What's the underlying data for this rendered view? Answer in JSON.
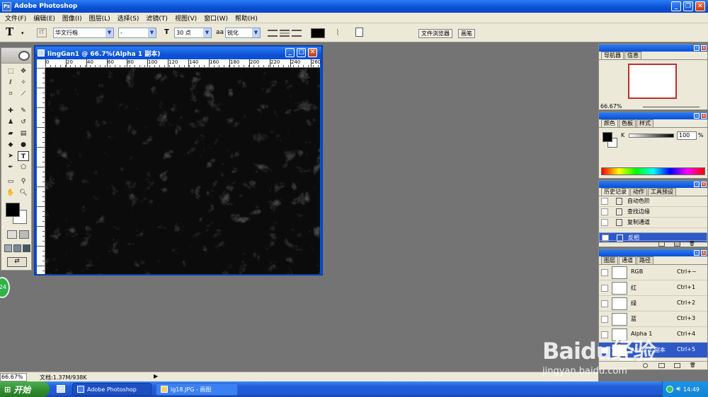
{
  "app": {
    "title": "Adobe Photoshop"
  },
  "menu": [
    "文件(F)",
    "编辑(E)",
    "图像(I)",
    "图层(L)",
    "选择(S)",
    "滤镜(T)",
    "视图(V)",
    "窗口(W)",
    "帮助(H)"
  ],
  "options": {
    "tool_glyph": "T",
    "font_family": "华文行楷",
    "font_style": "-",
    "font_size": "30 点",
    "antialias_label": "aa",
    "antialias": "锐化",
    "tabs": [
      "文件浏览器",
      "画笔"
    ]
  },
  "document": {
    "title": "lingGan1 @ 66.7%(Alpha 1 副本)",
    "ruler_ticks": [
      "0",
      "20",
      "40",
      "60",
      "80",
      "100",
      "120",
      "140",
      "160",
      "180",
      "200",
      "220",
      "240",
      "260"
    ]
  },
  "status": {
    "zoom": "66.67%",
    "doc": "文档:1.37M/938K"
  },
  "navigator": {
    "tabs": [
      "导航器",
      "信息"
    ],
    "zoom": "66.67%"
  },
  "color_panel": {
    "tabs": [
      "颜色",
      "色板",
      "样式"
    ],
    "channel_label": "K",
    "value": "100",
    "unit": "%"
  },
  "history": {
    "tabs": [
      "历史记录",
      "动作",
      "工具预设"
    ],
    "items": [
      {
        "label": "自动色阶",
        "selected": false
      },
      {
        "label": "查找边缘",
        "selected": false
      },
      {
        "label": "复制通道",
        "selected": false
      },
      {
        "label": "反相",
        "selected": true
      }
    ]
  },
  "channels": {
    "tabs": [
      "图层",
      "通道",
      "路径"
    ],
    "items": [
      {
        "name": "RGB",
        "shortcut": "Ctrl+~",
        "selected": false
      },
      {
        "name": "红",
        "shortcut": "Ctrl+1",
        "selected": false
      },
      {
        "name": "绿",
        "shortcut": "Ctrl+2",
        "selected": false
      },
      {
        "name": "蓝",
        "shortcut": "Ctrl+3",
        "selected": false
      },
      {
        "name": "Alpha 1",
        "shortcut": "Ctrl+4",
        "selected": false
      },
      {
        "name": "Alpha 1 副本",
        "shortcut": "Ctrl+5",
        "selected": true
      }
    ]
  },
  "taskbar": {
    "start": "开始",
    "tasks": [
      "Adobe Photoshop",
      "lg18.JPG - 画图"
    ],
    "time": "14:49",
    "badge": "24"
  },
  "watermark": {
    "brand": "Baidu经验",
    "url": "jingyan.baidu.com"
  },
  "colors": {
    "titlebar": "#0a4fd4",
    "chrome": "#ece9d8",
    "workspace": "#747474",
    "selection": "#2f59c8"
  }
}
